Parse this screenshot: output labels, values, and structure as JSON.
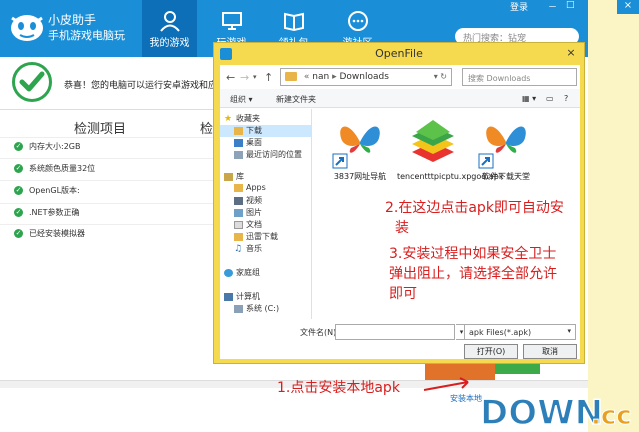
{
  "app": {
    "title": "小皮助手",
    "subtitle": "手机游戏电脑玩",
    "top_links": [
      "登录",
      "－",
      "□",
      "×"
    ],
    "search_placeholder": "热门搜索：钻宠",
    "nav_tabs": [
      {
        "label": "我的游戏",
        "icon": "user-icon",
        "active": true
      },
      {
        "label": "玩游戏",
        "icon": "monitor-icon",
        "active": false
      },
      {
        "label": "领礼包",
        "icon": "book-icon",
        "active": false
      },
      {
        "label": "游社区",
        "icon": "chat-icon",
        "active": false
      }
    ]
  },
  "check": {
    "message": "恭喜！您的电脑可以运行安卓游戏和应用啦！",
    "col_head": "检测项目",
    "col_head2": "检",
    "items": [
      "内存大小:2GB",
      "系统颜色质量32位",
      "OpenGL版本:",
      ".NET参数正确",
      "已经安装模拟器"
    ]
  },
  "footer": {
    "install_local": "安装本地"
  },
  "dialog": {
    "title": "OpenFile",
    "close": "×",
    "nav_up": "↑",
    "path": [
      "nan",
      "Downloads"
    ],
    "search_placeholder": "搜索 Downloads",
    "organize": "组织 ▾",
    "new_folder": "新建文件夹",
    "tree": [
      {
        "label": "收藏夹",
        "icon": "star-icon",
        "indent": 0,
        "selected": false
      },
      {
        "label": "下载",
        "icon": "download-folder-icon",
        "indent": 1,
        "selected": true
      },
      {
        "label": "桌面",
        "icon": "desktop-icon",
        "indent": 1,
        "selected": false
      },
      {
        "label": "最近访问的位置",
        "icon": "recent-icon",
        "indent": 1,
        "selected": false
      },
      {
        "label": "库",
        "icon": "library-icon",
        "indent": 0,
        "selected": false
      },
      {
        "label": "Apps",
        "icon": "folder-icon",
        "indent": 1,
        "selected": false
      },
      {
        "label": "视频",
        "icon": "video-icon",
        "indent": 1,
        "selected": false
      },
      {
        "label": "图片",
        "icon": "picture-icon",
        "indent": 1,
        "selected": false
      },
      {
        "label": "文档",
        "icon": "document-icon",
        "indent": 1,
        "selected": false
      },
      {
        "label": "迅雷下载",
        "icon": "folder-icon",
        "indent": 1,
        "selected": false
      },
      {
        "label": "音乐",
        "icon": "music-icon",
        "indent": 1,
        "selected": false
      },
      {
        "label": "家庭组",
        "icon": "homegroup-icon",
        "indent": 0,
        "selected": false
      },
      {
        "label": "计算机",
        "icon": "computer-icon",
        "indent": 0,
        "selected": false
      },
      {
        "label": "系统 (C:)",
        "icon": "drive-icon",
        "indent": 1,
        "selected": false
      }
    ],
    "files": [
      {
        "name": "3837网址导航",
        "icon": "butterfly-shortcut-icon"
      },
      {
        "name": "tencentttpicptu.xpgod.apk",
        "icon": "bluestacks-apk-icon"
      },
      {
        "name": "软件下载天堂",
        "icon": "butterfly-shortcut-icon"
      }
    ],
    "filename_label": "文件名(N):",
    "filename_value": "",
    "filetype": "apk Files(*.apk)",
    "open_btn": "打开(O)",
    "cancel_btn": "取消"
  },
  "annotations": {
    "step1": "1.点击安装本地apk",
    "step2_line1": "2.在这边点击apk即可自动安",
    "step2_line2": "装",
    "step3_line1": "3.安装过程中如果安全卫士",
    "step3_line2": "弹出阻止，请选择全部允许",
    "step3_line3": "即可"
  },
  "watermark": {
    "text_main": "DOWN",
    "text_tld": ".cc"
  },
  "colors": {
    "header_blue": "#1a8fd8",
    "active_tab": "#0d6fb7",
    "dialog_frame": "#f5d94e",
    "annotation_red": "#d81e1e",
    "check_green": "#2da44e"
  }
}
